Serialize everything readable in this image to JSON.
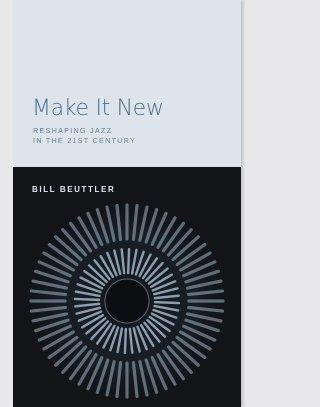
{
  "cover": {
    "title": "Make It New",
    "subtitle_line1": "RESHAPING JAZZ",
    "subtitle_line2": "IN THE 21ST CENTURY",
    "author": "BILL BEUTTLER"
  },
  "colors": {
    "page_background": "#e8e8ea",
    "top_panel": "#dde4ec",
    "title": "#4f6f8a",
    "subtitle": "#6b8196",
    "bottom_panel": "#121418",
    "author": "#e6e9ee",
    "art_stroke": "#9fb6c8"
  },
  "art": {
    "description_icon": "radial-rings-artwork",
    "outer_spokes": 60,
    "inner_spokes": 44
  }
}
